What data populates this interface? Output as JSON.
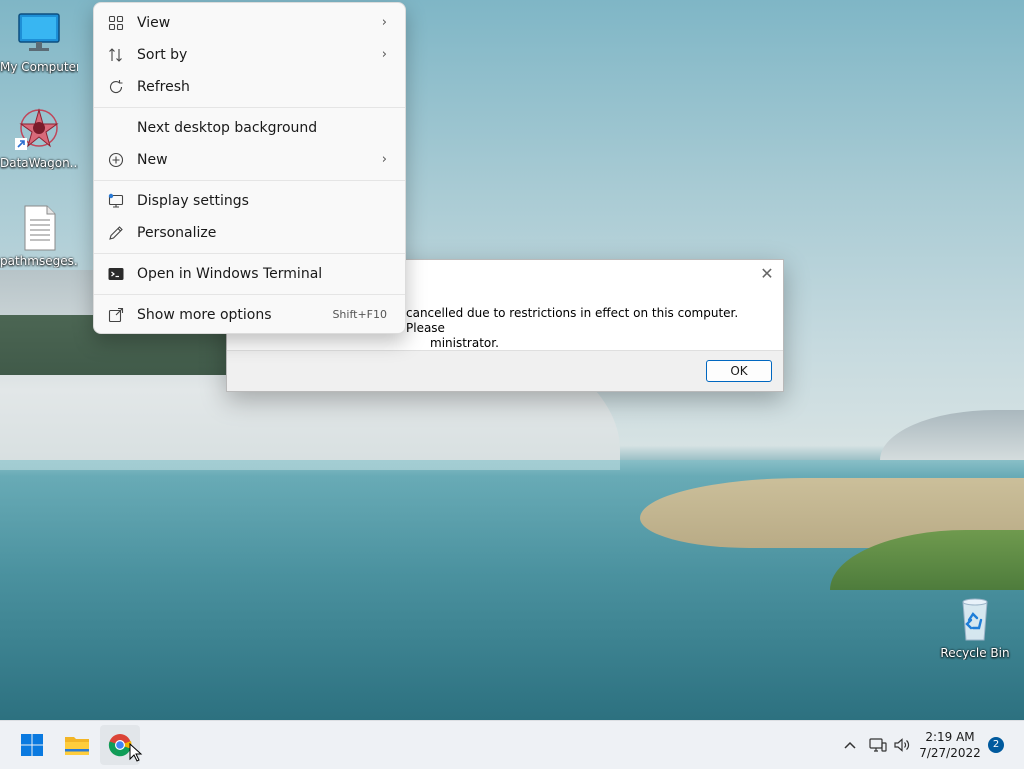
{
  "desktop": {
    "icons": [
      {
        "label": "My Computer"
      },
      {
        "label": "DataWagon..."
      },
      {
        "label": "pathmseges..."
      },
      {
        "label": "Recycle Bin"
      }
    ]
  },
  "context_menu": {
    "items": [
      {
        "label": "View",
        "icon": "grid-icon",
        "submenu": true
      },
      {
        "label": "Sort by",
        "icon": "sort-icon",
        "submenu": true
      },
      {
        "label": "Refresh",
        "icon": "refresh-icon"
      },
      {
        "label": "Next desktop background"
      },
      {
        "label": "New",
        "icon": "plus-circle-icon",
        "submenu": true
      },
      {
        "label": "Display settings",
        "icon": "display-icon"
      },
      {
        "label": "Personalize",
        "icon": "pen-icon"
      },
      {
        "label": "Open in Windows Terminal",
        "icon": "terminal-icon"
      },
      {
        "label": "Show more options",
        "icon": "share-icon",
        "shortcut": "Shift+F10"
      }
    ],
    "arrow": "›"
  },
  "dialog": {
    "message_line1": "cancelled due to restrictions in effect on this computer. Please",
    "message_line2": "ministrator.",
    "ok_label": "OK",
    "close_glyph": "✕"
  },
  "taskbar": {
    "apps": [
      "start",
      "file-explorer",
      "chrome"
    ],
    "tray_chevron": "^",
    "clock_time": "2:19 AM",
    "clock_date": "7/27/2022",
    "notification_count": "2",
    "accent": "#0067c0"
  }
}
